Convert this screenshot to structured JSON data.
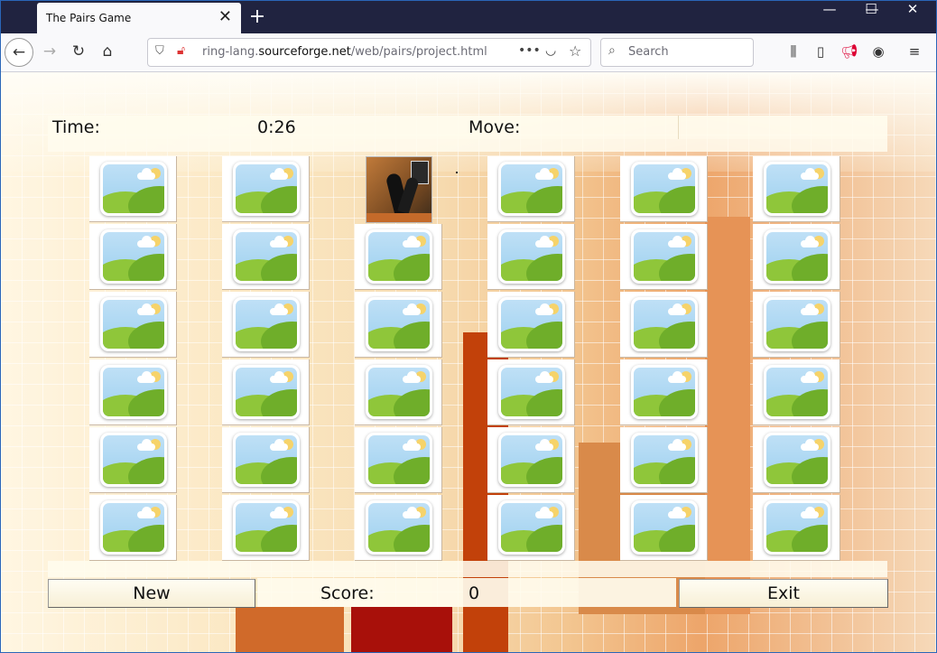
{
  "browser": {
    "tab_title": "The Pairs Game",
    "tab_close": "✕",
    "new_tab": "+",
    "url_prefix": "ring-lang.",
    "url_domain": "sourceforge.net",
    "url_path": "/web/pairs/project.html",
    "search_placeholder": "Search",
    "window_min": "—",
    "window_max": "☐",
    "window_close": "✕"
  },
  "game": {
    "time_label": "Time:",
    "time_value": "0:26",
    "move_label": "Move:",
    "move_value": "",
    "new_button": "New",
    "score_label": "Score:",
    "score_value": "0",
    "exit_button": "Exit",
    "grid": {
      "columns": 6,
      "rows": 6,
      "revealed_card": {
        "column": 3,
        "row": 1
      }
    }
  }
}
